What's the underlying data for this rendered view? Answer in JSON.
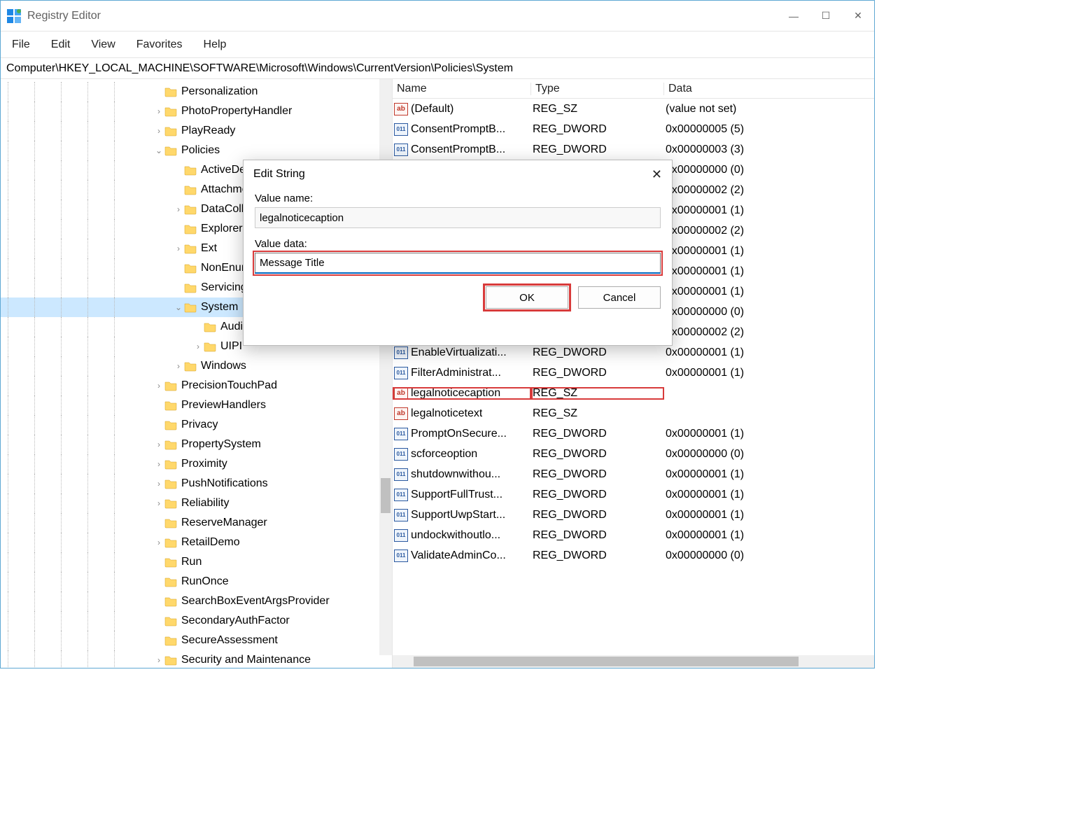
{
  "window": {
    "title": "Registry Editor",
    "min": "—",
    "max": "☐",
    "close": "✕"
  },
  "menu": {
    "file": "File",
    "edit": "Edit",
    "view": "View",
    "favorites": "Favorites",
    "help": "Help"
  },
  "address": "Computer\\HKEY_LOCAL_MACHINE\\SOFTWARE\\Microsoft\\Windows\\CurrentVersion\\Policies\\System",
  "tree": [
    {
      "indent": 6,
      "expander": "",
      "label": "Personalization"
    },
    {
      "indent": 6,
      "expander": "›",
      "label": "PhotoPropertyHandler"
    },
    {
      "indent": 6,
      "expander": "›",
      "label": "PlayReady"
    },
    {
      "indent": 6,
      "expander": "v",
      "label": "Policies"
    },
    {
      "indent": 7,
      "expander": "",
      "label": "ActiveDesktop"
    },
    {
      "indent": 7,
      "expander": "",
      "label": "Attachments"
    },
    {
      "indent": 7,
      "expander": "›",
      "label": "DataCollection"
    },
    {
      "indent": 7,
      "expander": "",
      "label": "Explorer"
    },
    {
      "indent": 7,
      "expander": "›",
      "label": "Ext"
    },
    {
      "indent": 7,
      "expander": "",
      "label": "NonEnum"
    },
    {
      "indent": 7,
      "expander": "",
      "label": "Servicing"
    },
    {
      "indent": 7,
      "expander": "v",
      "label": "System",
      "selected": true
    },
    {
      "indent": 8,
      "expander": "",
      "label": "Audit"
    },
    {
      "indent": 8,
      "expander": "›",
      "label": "UIPI"
    },
    {
      "indent": 7,
      "expander": "›",
      "label": "Windows"
    },
    {
      "indent": 6,
      "expander": "›",
      "label": "PrecisionTouchPad"
    },
    {
      "indent": 6,
      "expander": "",
      "label": "PreviewHandlers"
    },
    {
      "indent": 6,
      "expander": "",
      "label": "Privacy"
    },
    {
      "indent": 6,
      "expander": "›",
      "label": "PropertySystem"
    },
    {
      "indent": 6,
      "expander": "›",
      "label": "Proximity"
    },
    {
      "indent": 6,
      "expander": "›",
      "label": "PushNotifications"
    },
    {
      "indent": 6,
      "expander": "›",
      "label": "Reliability"
    },
    {
      "indent": 6,
      "expander": "",
      "label": "ReserveManager"
    },
    {
      "indent": 6,
      "expander": "›",
      "label": "RetailDemo"
    },
    {
      "indent": 6,
      "expander": "",
      "label": "Run"
    },
    {
      "indent": 6,
      "expander": "",
      "label": "RunOnce"
    },
    {
      "indent": 6,
      "expander": "",
      "label": "SearchBoxEventArgsProvider"
    },
    {
      "indent": 6,
      "expander": "",
      "label": "SecondaryAuthFactor"
    },
    {
      "indent": 6,
      "expander": "",
      "label": "SecureAssessment"
    },
    {
      "indent": 6,
      "expander": "›",
      "label": "Security and Maintenance"
    }
  ],
  "columns": {
    "name": "Name",
    "type": "Type",
    "data": "Data"
  },
  "values": [
    {
      "icon": "sz",
      "name": "(Default)",
      "type": "REG_SZ",
      "data": "(value not set)"
    },
    {
      "icon": "dw",
      "name": "ConsentPromptB...",
      "type": "REG_DWORD",
      "data": "0x00000005 (5)"
    },
    {
      "icon": "dw",
      "name": "ConsentPromptB...",
      "type": "REG_DWORD",
      "data": "0x00000003 (3)"
    },
    {
      "icon": "dw",
      "name": "",
      "type": "",
      "data": "0x00000000 (0)"
    },
    {
      "icon": "dw",
      "name": "",
      "type": "",
      "data": "0x00000002 (2)"
    },
    {
      "icon": "dw",
      "name": "",
      "type": "",
      "data": "0x00000001 (1)"
    },
    {
      "icon": "dw",
      "name": "",
      "type": "",
      "data": "0x00000002 (2)"
    },
    {
      "icon": "dw",
      "name": "",
      "type": "",
      "data": "0x00000001 (1)"
    },
    {
      "icon": "dw",
      "name": "",
      "type": "",
      "data": "0x00000001 (1)"
    },
    {
      "icon": "dw",
      "name": "",
      "type": "",
      "data": "0x00000001 (1)"
    },
    {
      "icon": "dw",
      "name": "",
      "type": "",
      "data": "0x00000000 (0)"
    },
    {
      "icon": "dw",
      "name": "",
      "type": "",
      "data": "0x00000002 (2)"
    },
    {
      "icon": "dw",
      "name": "EnableVirtualizati...",
      "type": "REG_DWORD",
      "data": "0x00000001 (1)"
    },
    {
      "icon": "dw",
      "name": "FilterAdministrat...",
      "type": "REG_DWORD",
      "data": "0x00000001 (1)"
    },
    {
      "icon": "sz",
      "name": "legalnoticecaption",
      "type": "REG_SZ",
      "data": "",
      "highlight": true
    },
    {
      "icon": "sz",
      "name": "legalnoticetext",
      "type": "REG_SZ",
      "data": ""
    },
    {
      "icon": "dw",
      "name": "PromptOnSecure...",
      "type": "REG_DWORD",
      "data": "0x00000001 (1)"
    },
    {
      "icon": "dw",
      "name": "scforceoption",
      "type": "REG_DWORD",
      "data": "0x00000000 (0)"
    },
    {
      "icon": "dw",
      "name": "shutdownwithou...",
      "type": "REG_DWORD",
      "data": "0x00000001 (1)"
    },
    {
      "icon": "dw",
      "name": "SupportFullTrust...",
      "type": "REG_DWORD",
      "data": "0x00000001 (1)"
    },
    {
      "icon": "dw",
      "name": "SupportUwpStart...",
      "type": "REG_DWORD",
      "data": "0x00000001 (1)"
    },
    {
      "icon": "dw",
      "name": "undockwithoutlo...",
      "type": "REG_DWORD",
      "data": "0x00000001 (1)"
    },
    {
      "icon": "dw",
      "name": "ValidateAdminCo...",
      "type": "REG_DWORD",
      "data": "0x00000000 (0)"
    }
  ],
  "dialog": {
    "title": "Edit String",
    "close": "✕",
    "value_name_label": "Value name:",
    "value_name": "legalnoticecaption",
    "value_data_label": "Value data:",
    "value_data": "Message Title",
    "ok": "OK",
    "cancel": "Cancel"
  }
}
